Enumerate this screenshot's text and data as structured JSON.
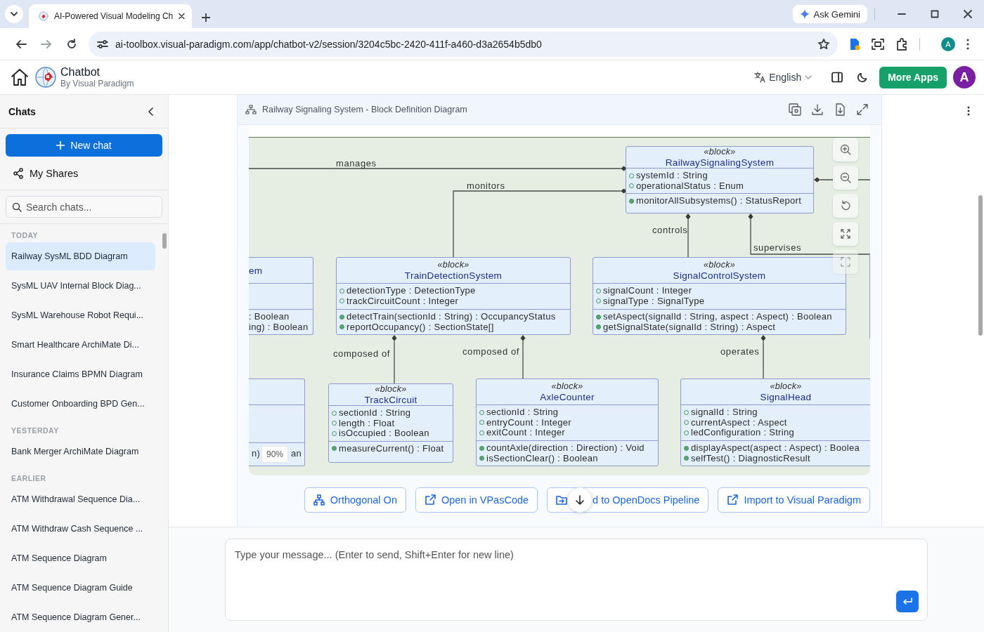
{
  "browser": {
    "tabs": [
      {
        "title": "AI-Powered Visual Modeling Ch",
        "selected": true
      }
    ],
    "ask_gemini": "Ask Gemini",
    "url": "ai-toolbox.visual-paradigm.com/app/chatbot-v2/session/3204c5bc-2420-411f-a460-d3a2654b5db0",
    "profile": "A"
  },
  "app_header": {
    "title": "Chatbot",
    "subtitle": "By Visual Paradigm",
    "language": "English",
    "more_apps": "More Apps",
    "avatar": "A"
  },
  "sidebar": {
    "title": "Chats",
    "new_chat": "New chat",
    "my_shares": "My Shares",
    "search": {
      "placeholder": "Search chats..."
    },
    "groups": [
      {
        "label": "TODAY",
        "items": [
          {
            "title": "Railway SysML BDD Diagram",
            "selected": true
          },
          {
            "title": "SysML UAV Internal Block Diag...",
            "selected": false
          },
          {
            "title": "SysML Warehouse Robot Requi...",
            "selected": false
          },
          {
            "title": "Smart Healthcare ArchiMate Di...",
            "selected": false
          },
          {
            "title": "Insurance Claims BPMN Diagram",
            "selected": false
          },
          {
            "title": "Customer Onboarding BPD Gen...",
            "selected": false
          }
        ]
      },
      {
        "label": "YESTERDAY",
        "items": [
          {
            "title": "Bank Merger ArchiMate Diagram",
            "selected": false
          }
        ]
      },
      {
        "label": "EARLIER",
        "items": [
          {
            "title": "ATM Withdrawal Sequence Dia...",
            "selected": false
          },
          {
            "title": "ATM Withdraw Cash Sequence ...",
            "selected": false
          },
          {
            "title": "ATM Sequence Diagram",
            "selected": false
          },
          {
            "title": "ATM Sequence Diagram Guide",
            "selected": false
          },
          {
            "title": "ATM Sequence Diagram Gener...",
            "selected": false
          }
        ]
      }
    ]
  },
  "diagram": {
    "title": "Railway Signaling System - Block Definition Diagram",
    "zoom": "90%",
    "blocks": [
      {
        "stereotype": "«block»",
        "name": "RailwaySignalingSystem",
        "attributes": [
          "systemId : String",
          "operationalStatus : Enum"
        ],
        "operations": [
          "monitorAllSubsystems() : StatusReport"
        ]
      },
      {
        "name": "em",
        "operations": [
          ": Boolean",
          "ing) : Boolean"
        ]
      },
      {
        "stereotype": "«block»",
        "name": "TrainDetectionSystem",
        "attributes": [
          "detectionType : DetectionType",
          "trackCircuitCount : Integer"
        ],
        "operations": [
          "detectTrain(sectionId : String) : OccupancyStatus",
          "reportOccupancy() : SectionState[]"
        ]
      },
      {
        "stereotype": "«block»",
        "name": "SignalControlSystem",
        "attributes": [
          "signalCount : Integer",
          "signalType : SignalType"
        ],
        "operations": [
          "setAspect(signalId : String, aspect : Aspect) : Boolean",
          "getSignalState(signalId : String) : Aspect"
        ]
      },
      {
        "operations": [
          "n)",
          "an"
        ]
      },
      {
        "stereotype": "«block»",
        "name": "TrackCircuit",
        "attributes": [
          "sectionId : String",
          "length : Float",
          "isOccupied : Boolean"
        ],
        "operations": [
          "measureCurrent() : Float"
        ]
      },
      {
        "stereotype": "«block»",
        "name": "AxleCounter",
        "attributes": [
          "sectionId : String",
          "entryCount : Integer",
          "exitCount : Integer"
        ],
        "operations": [
          "countAxle(direction : Direction) : Void",
          "isSectionClear() : Boolean"
        ]
      },
      {
        "stereotype": "«block»",
        "name": "SignalHead",
        "attributes": [
          "signalId : String",
          "currentAspect : Aspect",
          "ledConfiguration : String"
        ],
        "operations": [
          "displayAspect(aspect : Aspect) : Boolea",
          "selfTest() : DiagnosticResult"
        ]
      }
    ],
    "edges": [
      {
        "kind": "labeled",
        "label": "manages"
      },
      {
        "kind": "labeled",
        "label": "monitors"
      },
      {
        "kind": "plain"
      },
      {
        "kind": "labeled",
        "label": "controls"
      },
      {
        "kind": "labeled",
        "label": "supervises"
      },
      {
        "kind": "labeled",
        "label": "composed of"
      },
      {
        "kind": "labeled",
        "label": "composed of"
      },
      {
        "kind": "labeled",
        "label": "operates"
      }
    ],
    "buttons": [
      {
        "kind": "layout",
        "label": "Orthogonal On"
      },
      {
        "kind": "external",
        "label": "Open in VPasCode"
      },
      {
        "kind": "folder",
        "label": "d to OpenDocs Pipeline"
      },
      {
        "kind": "external",
        "label": "Import to Visual Paradigm"
      }
    ]
  },
  "composer": {
    "placeholder": "Type your message... (Enter to send, Shift+Enter for new line)"
  }
}
